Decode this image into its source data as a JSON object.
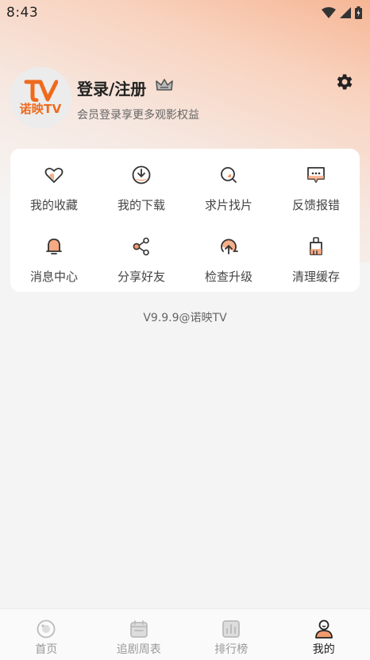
{
  "status_bar": {
    "time": "8:43"
  },
  "profile": {
    "avatar_logo": "TV",
    "avatar_brand": "诺映TV",
    "login_title": "登录/注册",
    "subtitle": "会员登录享更多观影权益"
  },
  "grid": [
    {
      "label": "我的收藏",
      "icon": "heart-icon"
    },
    {
      "label": "我的下载",
      "icon": "download-icon"
    },
    {
      "label": "求片找片",
      "icon": "search-film-icon"
    },
    {
      "label": "反馈报错",
      "icon": "feedback-icon"
    },
    {
      "label": "消息中心",
      "icon": "bell-icon"
    },
    {
      "label": "分享好友",
      "icon": "share-icon"
    },
    {
      "label": "检查升级",
      "icon": "upgrade-icon"
    },
    {
      "label": "清理缓存",
      "icon": "broom-icon"
    }
  ],
  "version": "V9.9.9@诺映TV",
  "tabs": [
    {
      "label": "首页",
      "icon": "home-icon",
      "active": false
    },
    {
      "label": "追剧周表",
      "icon": "calendar-icon",
      "active": false
    },
    {
      "label": "排行榜",
      "icon": "chart-icon",
      "active": false
    },
    {
      "label": "我的",
      "icon": "profile-icon",
      "active": true
    }
  ],
  "colors": {
    "accent": "#f39b6d",
    "brand": "#ef6a1d",
    "icon_stroke": "#333333"
  }
}
